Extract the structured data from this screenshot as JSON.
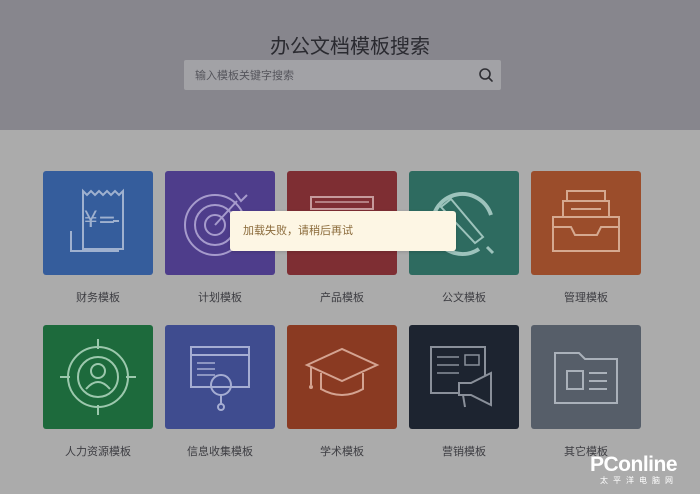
{
  "header": {
    "title": "办公文档模板搜索",
    "search_placeholder": "输入模板关键字搜索"
  },
  "categories": [
    {
      "label": "财务模板",
      "color": "#355d9c",
      "icon": "receipt-icon"
    },
    {
      "label": "计划模板",
      "color": "#4e3d8b",
      "icon": "target-icon"
    },
    {
      "label": "产品模板",
      "color": "#7e2e33",
      "icon": "product-box-icon"
    },
    {
      "label": "公文模板",
      "color": "#2e6b60",
      "icon": "hammer-sickle-icon"
    },
    {
      "label": "管理模板",
      "color": "#9b4d2b",
      "icon": "file-tray-icon"
    },
    {
      "label": "人力资源模板",
      "color": "#1d6a3c",
      "icon": "person-target-icon"
    },
    {
      "label": "信息收集模板",
      "color": "#3f4c8f",
      "icon": "search-document-icon"
    },
    {
      "label": "学术模板",
      "color": "#8a3a22",
      "icon": "graduation-cap-icon"
    },
    {
      "label": "营销模板",
      "color": "#1d2430",
      "icon": "megaphone-icon"
    },
    {
      "label": "其它模板",
      "color": "#565e69",
      "icon": "folder-icon"
    }
  ],
  "toast": {
    "message": "加载失败，请稍后再试"
  },
  "watermark": {
    "brand": "PConline",
    "sub": "太平洋电脑网"
  }
}
